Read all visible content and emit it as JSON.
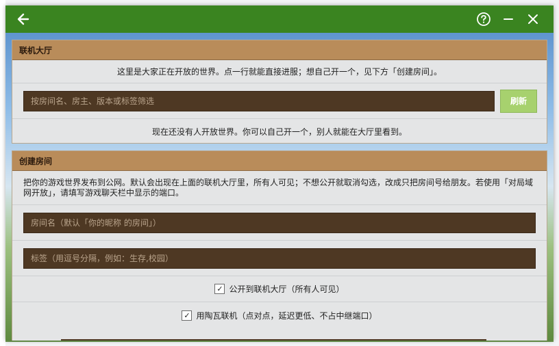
{
  "window": {
    "back_icon": "arrow-left-icon",
    "help_icon": "help-circle-icon",
    "minimize_icon": "minimize-icon",
    "close_icon": "close-icon"
  },
  "lobby": {
    "title": "联机大厅",
    "intro": "这里是大家正在开放的世界。点一行就能直接进服；想自己开一个，见下方「创建房间」。",
    "filter_placeholder": "按房间名、房主、版本或标签筛选",
    "refresh_label": "刷新",
    "empty_text": "现在还没有人开放世界。你可以自己开一个，别人就能在大厅里看到。"
  },
  "create": {
    "title": "创建房间",
    "description": "把你的游戏世界发布到公网。默认会出现在上面的联机大厅里，所有人可见；不想公开就取消勾选，改成只把房间号给朋友。若使用「对局域网开放」，请填写游戏聊天栏中显示的端口。",
    "room_name_placeholder": "房间名（默认「你的昵称 的房间」）",
    "tags_placeholder": "标签（用逗号分隔，例如：生存,校园）",
    "public_label": "公开到联机大厅（所有人可见）",
    "public_checked": true,
    "p2p_label": "用陶瓦联机（点对点，延迟更低、不占中继端口）",
    "p2p_checked": true
  },
  "colors": {
    "titlebar": "#3a8420",
    "panel_header": "#b98c5a",
    "input_bg": "#4e3823",
    "refresh_bg": "#a7d16e"
  }
}
